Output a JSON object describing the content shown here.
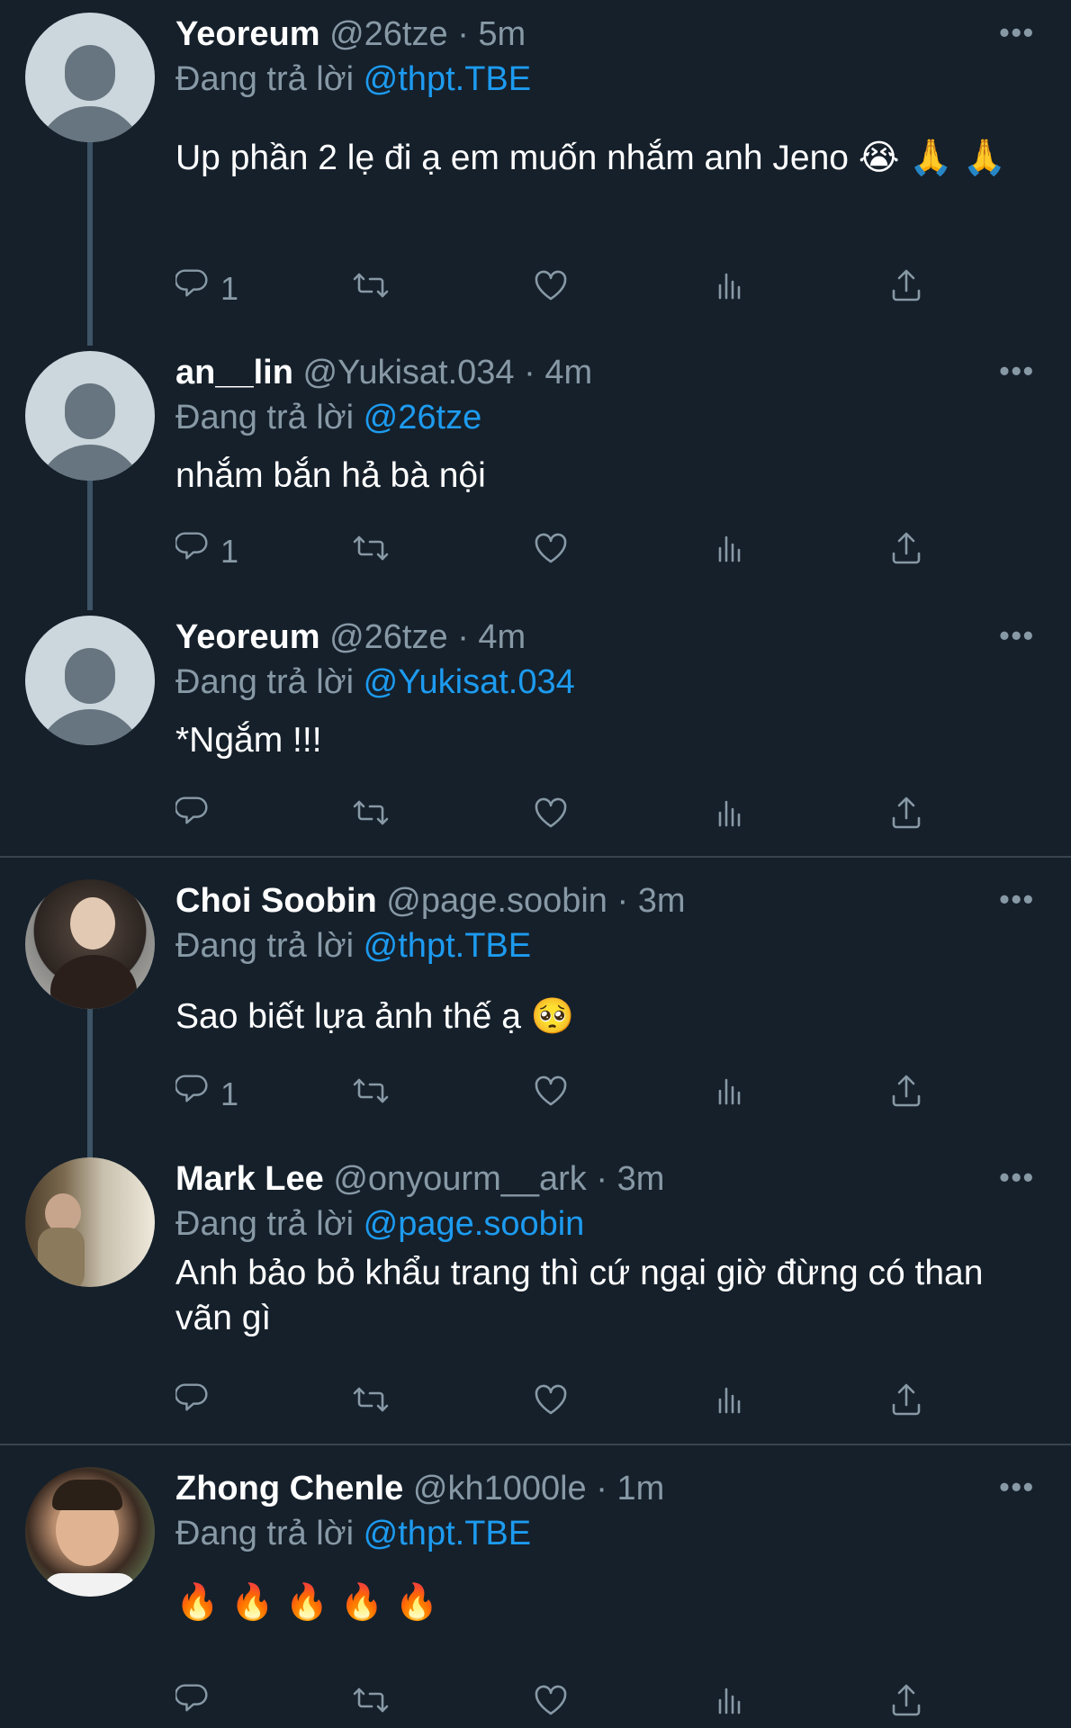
{
  "tweets": [
    {
      "name": "Yeoreum",
      "handle": "@26tze",
      "dot": "·",
      "time": "5m",
      "replying_prefix": "Đang trả lời",
      "replying_to": "@thpt.TBE",
      "text": "Up phần 2 lẹ đi ạ em muốn nhắm anh Jeno 😭 🙏 🙏",
      "reply_count": "1",
      "avatar": "default"
    },
    {
      "name": "an__lin",
      "handle": "@Yukisat.034",
      "dot": "·",
      "time": "4m",
      "replying_prefix": "Đang trả lời",
      "replying_to": "@26tze",
      "text": "nhắm bắn hả bà nội",
      "reply_count": "1",
      "avatar": "default"
    },
    {
      "name": "Yeoreum",
      "handle": "@26tze",
      "dot": "·",
      "time": "4m",
      "replying_prefix": "Đang trả lời",
      "replying_to": "@Yukisat.034",
      "text": "*Ngắm !!!",
      "reply_count": "",
      "avatar": "default"
    },
    {
      "name": "Choi Soobin",
      "handle": "@page.soobin",
      "dot": "·",
      "time": "3m",
      "replying_prefix": "Đang trả lời",
      "replying_to": "@thpt.TBE",
      "text": "Sao biết lựa ảnh thế ạ 🥺",
      "reply_count": "1",
      "avatar": "photo"
    },
    {
      "name": "Mark Lee",
      "handle": "@onyourm__ark",
      "dot": "·",
      "time": "3m",
      "replying_prefix": "Đang trả lời",
      "replying_to": "@page.soobin",
      "text": "Anh bảo bỏ khẩu trang thì cứ ngại giờ đừng có than vãn gì",
      "reply_count": "",
      "avatar": "photo"
    },
    {
      "name": "Zhong Chenle",
      "handle": "@kh1000le",
      "dot": "·",
      "time": "1m",
      "replying_prefix": "Đang trả lời",
      "replying_to": "@thpt.TBE",
      "text": "🔥 🔥 🔥 🔥 🔥",
      "reply_count": "",
      "avatar": "photo"
    }
  ],
  "more_label": "•••",
  "colors": {
    "background": "#15202b",
    "mention": "#1d9bf0",
    "secondary": "#8899a6",
    "divider": "#38444d"
  },
  "icons": [
    "reply-icon",
    "retweet-icon",
    "like-icon",
    "analytics-icon",
    "share-icon",
    "more-icon"
  ]
}
